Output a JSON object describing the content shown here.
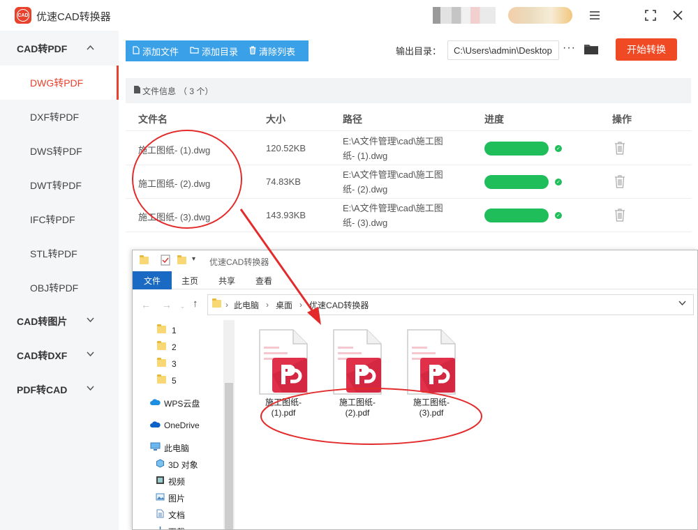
{
  "app": {
    "title": "优速CAD转换器",
    "logo_text": "CAD",
    "window_controls": [
      "menu-icon",
      "maximize-icon",
      "close-icon"
    ]
  },
  "sidebar": {
    "groups": [
      {
        "label": "CAD转PDF",
        "expanded": true,
        "chevron": "^"
      },
      {
        "label": "CAD转图片",
        "expanded": false,
        "chevron": "⌄"
      },
      {
        "label": "CAD转DXF",
        "expanded": false,
        "chevron": "⌄"
      },
      {
        "label": "PDF转CAD",
        "expanded": false,
        "chevron": "⌄"
      }
    ],
    "items": [
      {
        "label": "DWG转PDF",
        "active": true
      },
      {
        "label": "DXF转PDF",
        "active": false
      },
      {
        "label": "DWS转PDF",
        "active": false
      },
      {
        "label": "DWT转PDF",
        "active": false
      },
      {
        "label": "IFC转PDF",
        "active": false
      },
      {
        "label": "STL转PDF",
        "active": false
      },
      {
        "label": "OBJ转PDF",
        "active": false
      }
    ]
  },
  "toolbar": {
    "add_file": "添加文件",
    "add_dir": "添加目录",
    "clear_list": "清除列表",
    "output_label": "输出目录：",
    "output_path": "C:\\Users\\admin\\Desktop",
    "more": "···",
    "start": "开始转换"
  },
  "file_table": {
    "info_label": "文件信息",
    "count_text": "（ 3 个）",
    "headers": [
      "文件名",
      "大小",
      "路径",
      "进度",
      "操作"
    ],
    "rows": [
      {
        "name": "施工图纸- (1).dwg",
        "size": "120.52KB",
        "path_line1": "E:\\A文件管理\\cad\\施工图",
        "path_line2": "纸- (1).dwg",
        "progress": 1.0
      },
      {
        "name": "施工图纸- (2).dwg",
        "size": "74.83KB",
        "path_line1": "E:\\A文件管理\\cad\\施工图",
        "path_line2": "纸- (2).dwg",
        "progress": 1.0
      },
      {
        "name": "施工图纸- (3).dwg",
        "size": "143.93KB",
        "path_line1": "E:\\A文件管理\\cad\\施工图",
        "path_line2": "纸- (3).dwg",
        "progress": 1.0
      }
    ]
  },
  "explorer": {
    "title": "优速CAD转换器",
    "ribbon_tabs": [
      "文件",
      "主页",
      "共享",
      "查看"
    ],
    "breadcrumb": [
      "此电脑",
      "桌面",
      "优速CAD转换器"
    ],
    "tree": [
      {
        "label": "1",
        "icon": "folder-icon"
      },
      {
        "label": "2",
        "icon": "folder-icon"
      },
      {
        "label": "3",
        "icon": "folder-icon"
      },
      {
        "label": "5",
        "icon": "folder-icon"
      },
      {
        "label": "WPS云盘",
        "icon": "cloud-icon"
      },
      {
        "label": "OneDrive",
        "icon": "onedrive-icon"
      },
      {
        "label": "此电脑",
        "icon": "computer-icon"
      },
      {
        "label": "3D 对象",
        "icon": "cube-icon"
      },
      {
        "label": "视频",
        "icon": "video-icon"
      },
      {
        "label": "图片",
        "icon": "picture-icon"
      },
      {
        "label": "文档",
        "icon": "document-icon"
      },
      {
        "label": "下载",
        "icon": "download-icon"
      }
    ],
    "files": [
      {
        "line1": "施工图纸-",
        "line2": "(1).pdf"
      },
      {
        "line1": "施工图纸-",
        "line2": "(2).pdf"
      },
      {
        "line1": "施工图纸-",
        "line2": "(3).pdf"
      }
    ]
  },
  "colors": {
    "accent_red": "#e8412c",
    "toolbar_blue": "#3aa0e8",
    "start_orange": "#f04a24",
    "progress_green": "#1fbe5b",
    "pdf_red": "#e0304a",
    "annotation_red": "#e32b2b"
  }
}
